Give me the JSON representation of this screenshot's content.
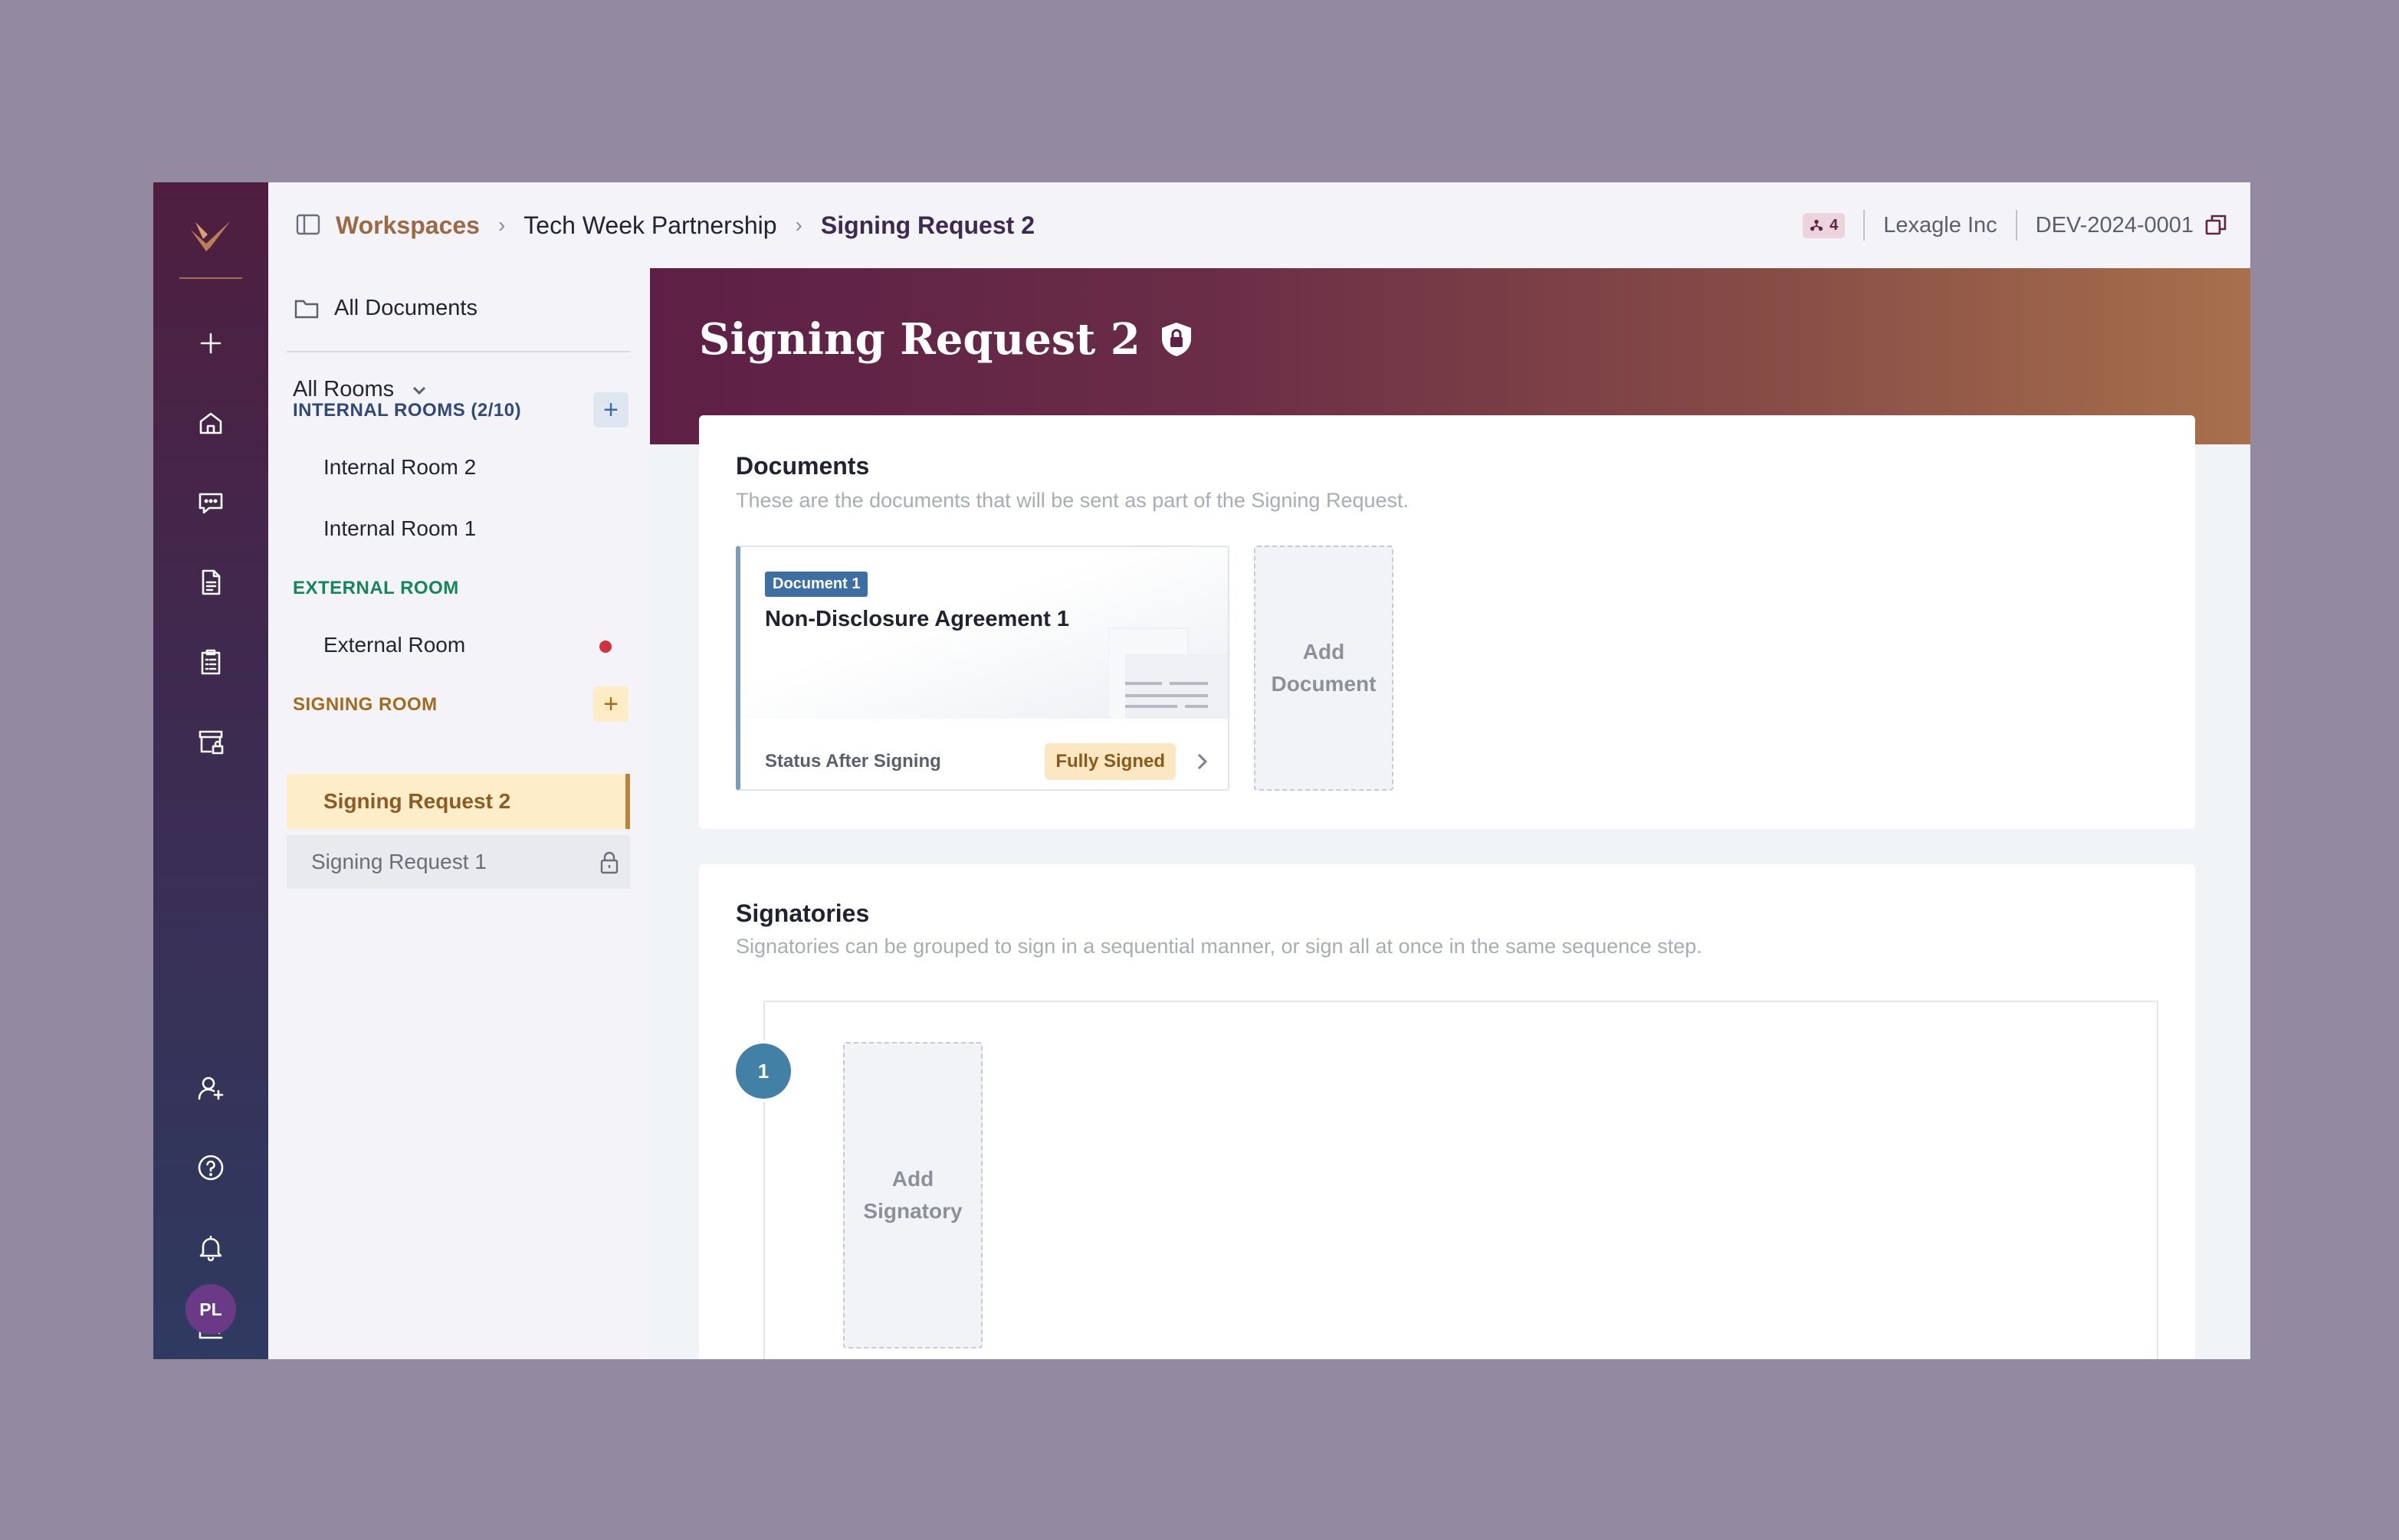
{
  "rail": {
    "avatar_initials": "PL",
    "icons": [
      "logo-icon",
      "plus-icon",
      "home-icon",
      "chat-icon",
      "document-icon",
      "clipboard-icon",
      "archive-lock-icon",
      "add-user-icon",
      "help-icon",
      "bell-icon",
      "chart-icon",
      "gear-icon"
    ]
  },
  "breadcrumb": {
    "workspaces": "Workspaces",
    "workspace": "Tech Week Partnership",
    "current": "Signing Request 2"
  },
  "topbar": {
    "members_count": "4",
    "org_name": "Lexagle Inc",
    "matter_id": "DEV-2024-0001"
  },
  "sidebar": {
    "all_documents": "All Documents",
    "all_rooms": "All Rooms",
    "internal_rooms_heading": "INTERNAL ROOMS (2/10)",
    "internal_rooms": [
      "Internal Room 2",
      "Internal Room 1"
    ],
    "external_room_heading": "EXTERNAL ROOM",
    "external_rooms": [
      "External Room"
    ],
    "signing_room_heading": "SIGNING ROOM",
    "signing_active": "Signing Request 2",
    "signing_locked": "Signing Request 1"
  },
  "page": {
    "title": "Signing Request 2"
  },
  "documents": {
    "title": "Documents",
    "subtitle": "These are the documents that will be sent as part of the Signing Request.",
    "items": [
      {
        "tag": "Document 1",
        "name": "Non-Disclosure Agreement 1",
        "status_label": "Status After Signing",
        "status_value": "Fully Signed"
      }
    ],
    "add_label_line1": "Add",
    "add_label_line2": "Document"
  },
  "signatories": {
    "title": "Signatories",
    "subtitle": "Signatories can be grouped to sign in a sequential manner, or sign all at once in the same sequence step.",
    "sequence_step": "1",
    "add_label_line1": "Add",
    "add_label_line2": "Signatory"
  },
  "colors": {
    "brand_primary": "#5d1f45",
    "accent_gold": "#b9843c",
    "internal_heading": "#2f4a7a",
    "external_heading": "#13875a",
    "signing_heading": "#a26b1f",
    "sequence_blue": "#4380a6"
  }
}
